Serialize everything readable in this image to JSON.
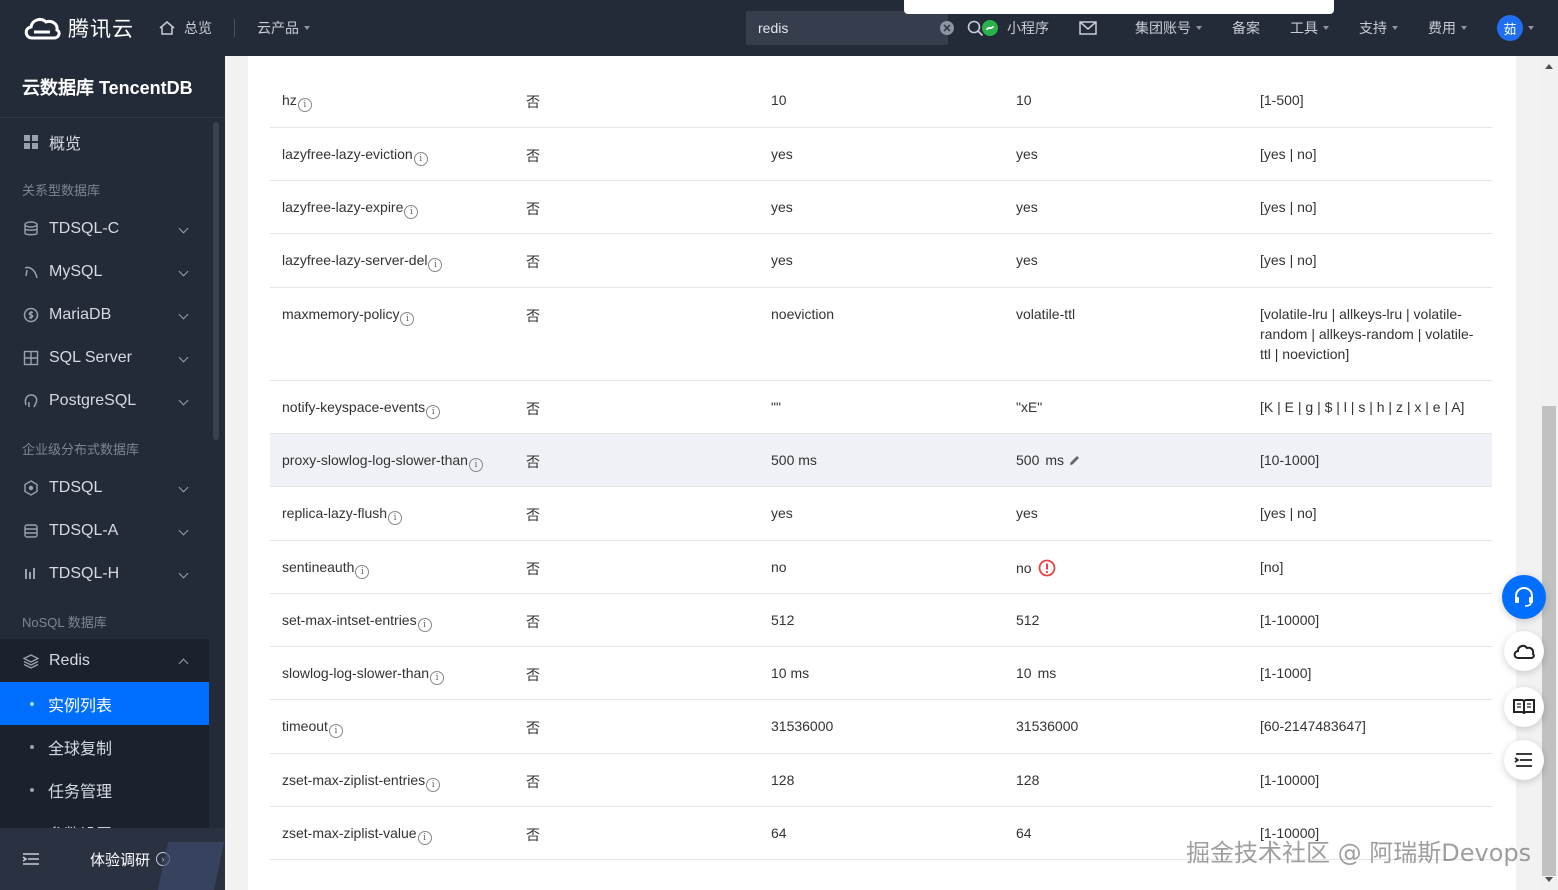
{
  "header": {
    "brand": "腾讯云",
    "home_label": "总览",
    "products_label": "云产品",
    "search_value": "redis",
    "nav": [
      {
        "label": "小程序",
        "icon": "mini-program-icon"
      },
      {
        "label": "",
        "icon": "mail-icon"
      },
      {
        "label": "集团账号",
        "icon": ""
      },
      {
        "label": "备案",
        "icon": ""
      },
      {
        "label": "工具",
        "icon": ""
      },
      {
        "label": "支持",
        "icon": ""
      },
      {
        "label": "费用",
        "icon": ""
      }
    ],
    "avatar_text": "茹"
  },
  "sidebar": {
    "title": "云数据库 TencentDB",
    "overview": "概览",
    "groups": [
      {
        "title": "关系型数据库",
        "items": [
          "TDSQL-C",
          "MySQL",
          "MariaDB",
          "SQL Server",
          "PostgreSQL"
        ]
      },
      {
        "title": "企业级分布式数据库",
        "items": [
          "TDSQL",
          "TDSQL-A",
          "TDSQL-H"
        ]
      },
      {
        "title": "NoSQL 数据库",
        "items": [
          "Redis"
        ]
      }
    ],
    "redis_sub": [
      "实例列表",
      "全球复制",
      "任务管理",
      "参数设置"
    ],
    "footer_label": "体验调研"
  },
  "table": {
    "rows": [
      {
        "name": "hz",
        "restart": "否",
        "default": "10",
        "current": "10",
        "range": "[1-500]"
      },
      {
        "name": "lazyfree-lazy-eviction",
        "restart": "否",
        "default": "yes",
        "current": "yes",
        "range": "[yes | no]"
      },
      {
        "name": "lazyfree-lazy-expire",
        "restart": "否",
        "default": "yes",
        "current": "yes",
        "range": "[yes | no]"
      },
      {
        "name": "lazyfree-lazy-server-del",
        "restart": "否",
        "default": "yes",
        "current": "yes",
        "range": "[yes | no]"
      },
      {
        "name": "maxmemory-policy",
        "restart": "否",
        "default": "noeviction",
        "current": "volatile-ttl",
        "range": "[volatile-lru | allkeys-lru | volatile-random | allkeys-random | volatile-ttl | noeviction]"
      },
      {
        "name": "notify-keyspace-events",
        "restart": "否",
        "default": "\"\"",
        "current": "\"xE\"",
        "range": "[K | E | g | $ | l | s | h | z | x | e | A]"
      },
      {
        "name": "proxy-slowlog-log-slower-than",
        "restart": "否",
        "default": "500 ms",
        "current": "500",
        "current_unit": "ms",
        "range": "[10-1000]"
      },
      {
        "name": "replica-lazy-flush",
        "restart": "否",
        "default": "yes",
        "current": "yes",
        "range": "[yes | no]"
      },
      {
        "name": "sentineauth",
        "restart": "否",
        "default": "no",
        "current": "no",
        "range": "[no]"
      },
      {
        "name": "set-max-intset-entries",
        "restart": "否",
        "default": "512",
        "current": "512",
        "range": "[1-10000]"
      },
      {
        "name": "slowlog-log-slower-than",
        "restart": "否",
        "default": "10 ms",
        "current": "10",
        "current_unit": "ms",
        "range": "[1-1000]"
      },
      {
        "name": "timeout",
        "restart": "否",
        "default": "31536000",
        "current": "31536000",
        "range": "[60-2147483647]"
      },
      {
        "name": "zset-max-ziplist-entries",
        "restart": "否",
        "default": "128",
        "current": "128",
        "range": "[1-10000]"
      },
      {
        "name": "zset-max-ziplist-value",
        "restart": "否",
        "default": "64",
        "current": "64",
        "range": "[1-10000]"
      }
    ]
  },
  "watermark": "掘金技术社区 @ 阿瑞斯Devops",
  "colors": {
    "accent": "#006eff",
    "topbar": "#242b38",
    "warning": "#e54545"
  }
}
